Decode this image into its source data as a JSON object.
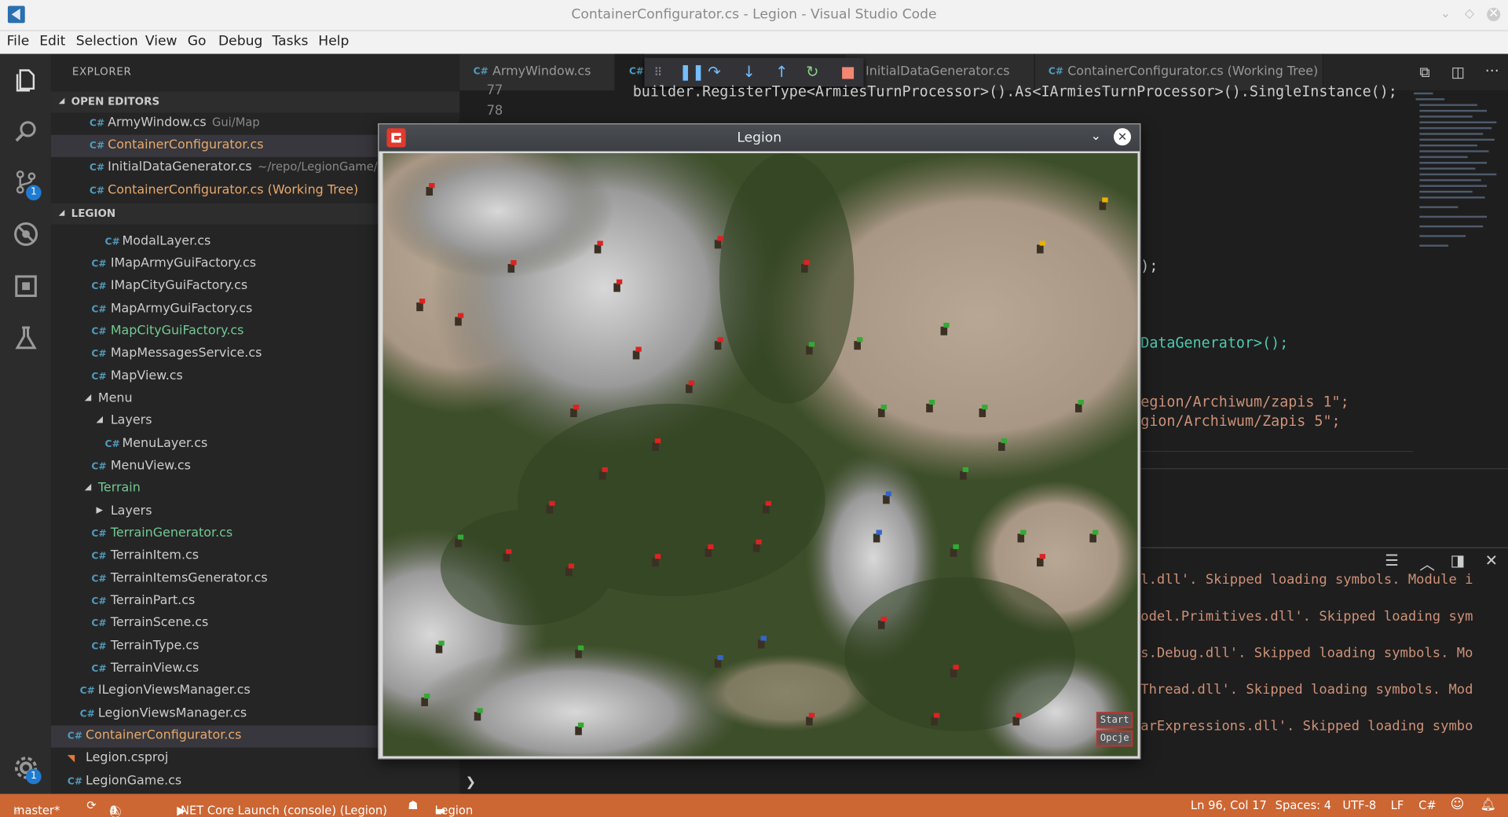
{
  "window": {
    "title": "ContainerConfigurator.cs - Legion - Visual Studio Code"
  },
  "menu": [
    "File",
    "Edit",
    "Selection",
    "View",
    "Go",
    "Debug",
    "Tasks",
    "Help"
  ],
  "activity": {
    "scm_badge": "1",
    "settings_badge": "1"
  },
  "explorer": {
    "header": "EXPLORER",
    "open_editors_title": "OPEN EDITORS",
    "open_editors": [
      {
        "name": "ArmyWindow.cs",
        "path": "Gui/Map"
      },
      {
        "name": "ContainerConfigurator.cs",
        "path": ""
      },
      {
        "name": "InitialDataGenerator.cs",
        "path": "~/repo/LegionGame/src"
      },
      {
        "name": "ContainerConfigurator.cs (Working Tree)",
        "path": ""
      }
    ],
    "project_title": "LEGION",
    "tree": [
      "ModalLayer.cs",
      "IMapArmyGuiFactory.cs",
      "IMapCityGuiFactory.cs",
      "MapArmyGuiFactory.cs",
      "MapCityGuiFactory.cs",
      "MapMessagesService.cs",
      "MapView.cs",
      "Menu",
      "Layers",
      "MenuLayer.cs",
      "MenuView.cs",
      "Terrain",
      "Layers",
      "TerrainGenerator.cs",
      "TerrainItem.cs",
      "TerrainItemsGenerator.cs",
      "TerrainPart.cs",
      "TerrainScene.cs",
      "TerrainType.cs",
      "TerrainView.cs",
      "ILegionViewsManager.cs",
      "LegionViewsManager.cs",
      "ContainerConfigurator.cs",
      "Legion.csproj",
      "LegionGame.cs"
    ]
  },
  "tabs": [
    "ArmyWindow.cs",
    "InitialDataGenerator.cs",
    "ContainerConfigurator.cs (Working Tree)"
  ],
  "editor": {
    "line_numbers": [
      "77",
      "78"
    ],
    "code": [
      "builder.RegisterType<ArmiesTurnProcessor>().As<IArmiesTurnProcessor>().SingleInstance();",
      ");",
      "DataGenerator>();",
      "egion/Archiwum/zapis 1\";",
      "gion/Archiwum/Zapis 5\";"
    ]
  },
  "output": [
    "l.dll'. Skipped loading symbols. Module i",
    "odel.Primitives.dll'. Skipped loading sym",
    "s.Debug.dll'. Skipped loading symbols. Mo",
    "Thread.dll'. Skipped loading symbols. Mod",
    "arExpressions.dll'. Skipped loading symbo"
  ],
  "panel_prompt": "❯",
  "game": {
    "title": "Legion",
    "start": "Start",
    "options": "Opcje"
  },
  "status": {
    "branch": "master*",
    "errors": "0",
    "warnings": "4",
    "launch": ".NET Core Launch (console) (Legion)",
    "folder": "Legion",
    "position": "Ln 96, Col 17",
    "spaces": "Spaces: 4",
    "encoding": "UTF-8",
    "eol": "LF",
    "language": "C#"
  },
  "colors": {
    "status_bar": "#cc6633",
    "accent": "#1f7bd1"
  }
}
